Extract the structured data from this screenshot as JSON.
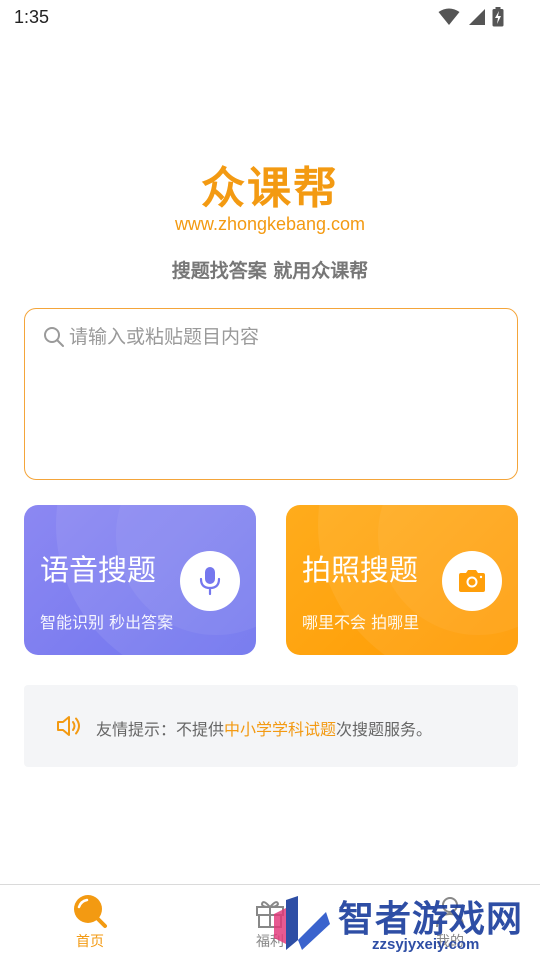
{
  "status_bar": {
    "time": "1:35"
  },
  "header": {
    "title": "众课帮",
    "url": "www.zhongkebang.com",
    "slogan": "搜题找答案 就用众课帮"
  },
  "search": {
    "placeholder": "请输入或粘贴题目内容"
  },
  "cards": {
    "voice": {
      "title": "语音搜题",
      "subtitle": "智能识别 秒出答案",
      "icon": "microphone-icon"
    },
    "photo": {
      "title": "拍照搜题",
      "subtitle": "哪里不会 拍哪里",
      "icon": "camera-icon"
    }
  },
  "notice": {
    "prefix": "友情提示：不提供",
    "highlight": "中小学学科试题",
    "suffix": "次搜题服务。",
    "icon": "speaker-icon"
  },
  "bottom_nav": {
    "items": [
      {
        "label": "首页",
        "icon": "search-home-icon",
        "active": true
      },
      {
        "label": "福利",
        "icon": "gift-icon",
        "active": false
      },
      {
        "label": "我的",
        "icon": "user-icon",
        "active": false
      }
    ]
  },
  "watermark": {
    "text": "智者游戏网",
    "domain": "zzsyjyxeiy.com"
  },
  "colors": {
    "accent": "#f39a12",
    "voice_card": "#7d7ff0",
    "photo_card": "#ffa40e",
    "notice_bg": "#f4f5f7"
  }
}
